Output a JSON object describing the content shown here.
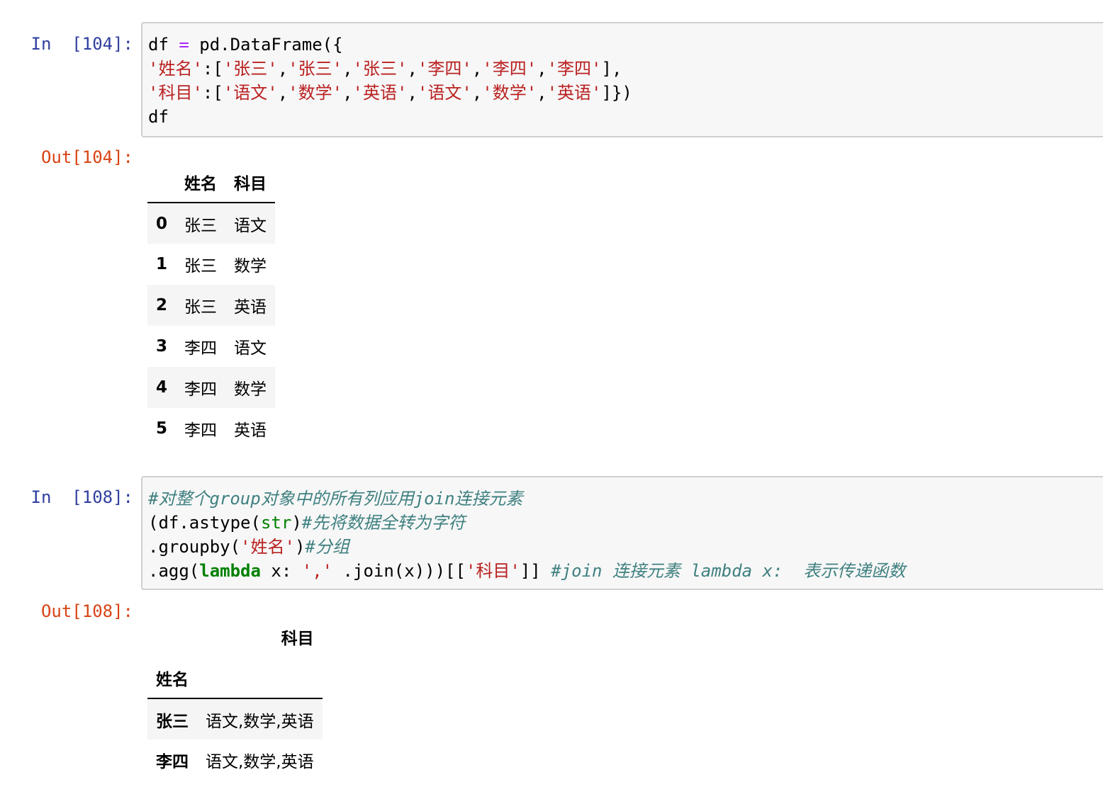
{
  "cells": [
    {
      "in_prompt": "In  [104]:",
      "out_prompt": "Out[104]:",
      "code": {
        "line1": {
          "a": "df ",
          "b": "=",
          "c": " pd.DataFrame({"
        },
        "line2": {
          "a": "'姓名'",
          "b": ":[",
          "c": "'张三'",
          "d": ",",
          "e": "'张三'",
          "f": ",",
          "g": "'张三'",
          "h": ",",
          "i": "'李四'",
          "j": ",",
          "k": "'李四'",
          "l": ",",
          "m": "'李四'",
          "n": "],"
        },
        "line3": {
          "a": "'科目'",
          "b": ":[",
          "c": "'语文'",
          "d": ",",
          "e": "'数学'",
          "f": ",",
          "g": "'英语'",
          "h": ",",
          "i": "'语文'",
          "j": ",",
          "k": "'数学'",
          "l": ",",
          "m": "'英语'",
          "n": "]})"
        },
        "line4": {
          "a": "df"
        }
      },
      "output_table": {
        "columns": [
          "姓名",
          "科目"
        ],
        "rows": [
          {
            "index": "0",
            "name": "张三",
            "subject": "语文"
          },
          {
            "index": "1",
            "name": "张三",
            "subject": "数学"
          },
          {
            "index": "2",
            "name": "张三",
            "subject": "英语"
          },
          {
            "index": "3",
            "name": "李四",
            "subject": "语文"
          },
          {
            "index": "4",
            "name": "李四",
            "subject": "数学"
          },
          {
            "index": "5",
            "name": "李四",
            "subject": "英语"
          }
        ]
      }
    },
    {
      "in_prompt": "In  [108]:",
      "out_prompt": "Out[108]:",
      "code": {
        "line1": {
          "a": "#对整个group对象中的所有列应用join连接元素"
        },
        "line2": {
          "a": "(df.astype(",
          "b": "str",
          "c": ")",
          "d": "#先将数据全转为字符"
        },
        "line3": {
          "a": ".groupby(",
          "b": "'姓名'",
          "c": ")",
          "d": "#分组"
        },
        "line4": {
          "a": ".agg(",
          "b": "lambda",
          "c": " x: ",
          "d": "','",
          "e": " .join(x)))[[",
          "f": "'科目'",
          "g": "]] ",
          "h": "#join 连接元素 lambda x:  表示传递函数"
        }
      },
      "output_table": {
        "column": "科目",
        "index_name": "姓名",
        "rows": [
          {
            "index": "张三",
            "value": "语文,数学,英语"
          },
          {
            "index": "李四",
            "value": "语文,数学,英语"
          }
        ]
      }
    }
  ],
  "colors": {
    "in_prompt": "#303f9f",
    "out_prompt": "#d84315",
    "string": "#ba2121",
    "comment": "#408080",
    "builtin": "#008000",
    "operator": "#aa22ff",
    "cell_background": "#f7f7f7",
    "cell_border": "#cfcfcf",
    "table_stripe": "#f5f5f5"
  }
}
